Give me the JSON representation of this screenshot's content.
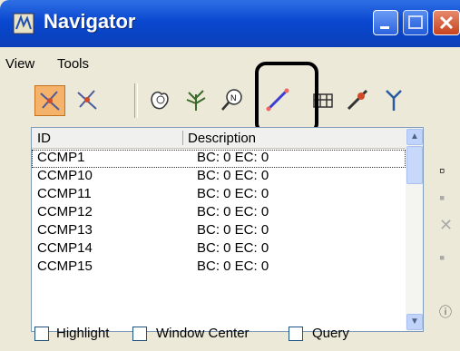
{
  "window": {
    "title": "Navigator"
  },
  "menu": [
    "View",
    "Tools"
  ],
  "toolbar": {
    "tools": [
      "view-mode-icon",
      "tool-mode-icon",
      "area-icon",
      "tree-icon",
      "search-icon",
      "line-icon",
      "bridge-icon",
      "pin-icon",
      "branch-icon"
    ],
    "active_tool": "view-mode-icon",
    "accent": "#f5b26b"
  },
  "list": {
    "columns": [
      "ID",
      "Description"
    ],
    "rows": [
      {
        "id": "CCMP1",
        "desc": "BC:  0 EC:  0"
      },
      {
        "id": "CCMP10",
        "desc": "BC:  0 EC:  0"
      },
      {
        "id": "CCMP11",
        "desc": "BC:  0 EC:  0"
      },
      {
        "id": "CCMP12",
        "desc": "BC:  0 EC:  0"
      },
      {
        "id": "CCMP13",
        "desc": "BC:  0 EC:  0"
      },
      {
        "id": "CCMP14",
        "desc": "BC:  0 EC:  0"
      },
      {
        "id": "CCMP15",
        "desc": "BC:  0 EC:  0"
      }
    ]
  },
  "options": [
    {
      "label": "Highlight",
      "checked": false
    },
    {
      "label": "Window Center",
      "checked": false
    },
    {
      "label": "Query",
      "checked": false
    }
  ]
}
